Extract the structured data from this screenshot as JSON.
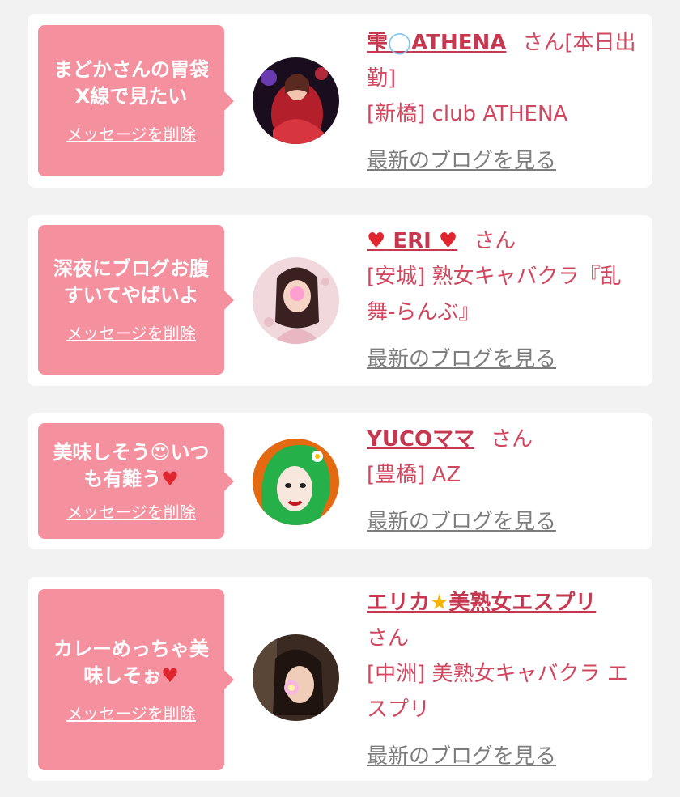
{
  "delete_label": "メッセージを削除",
  "blog_label": "最新のブログを見る",
  "san_label": "さん",
  "cards": [
    {
      "message": "まどかさんの胃袋X線で見たい",
      "name_pre": "雫",
      "name_icon": "bubbles-icon",
      "name_icon_glyph": "◯",
      "name_post": "ATHENA",
      "san": "さん[本日出勤]",
      "shop": "[新橋] club ATHENA"
    },
    {
      "message": "深夜にブログお腹すいてやばいよ",
      "name_pre": "♥",
      "name_icon": "heart-icon",
      "name_post": "ERI",
      "name_post_heart": "♥",
      "san": "さん",
      "shop": "[安城] 熟女キャバクラ『乱舞-らんぶ』"
    },
    {
      "message_pre": "美味しそう",
      "message_icon": "heart-eyes-emoji-icon",
      "message_icon_glyph": "😍",
      "message_post": "いつも有難う",
      "message_heart": "♥",
      "name": "YUCOママ",
      "san": "さん",
      "shop": "[豊橋] AZ"
    },
    {
      "message": "カレーめっちゃ美味しそぉ",
      "message_heart": "♥",
      "name_pre": "エリカ",
      "name_star": "★",
      "name_post": "美熟女エスプリ",
      "san": "さん",
      "shop": "[中洲] 美熟女キャバクラ エスプリ"
    }
  ],
  "colors": {
    "bubble": "#f5909f",
    "name": "#c6384f",
    "text": "#d0475f",
    "link": "#7d7d7d",
    "background": "#f2f2f2"
  }
}
